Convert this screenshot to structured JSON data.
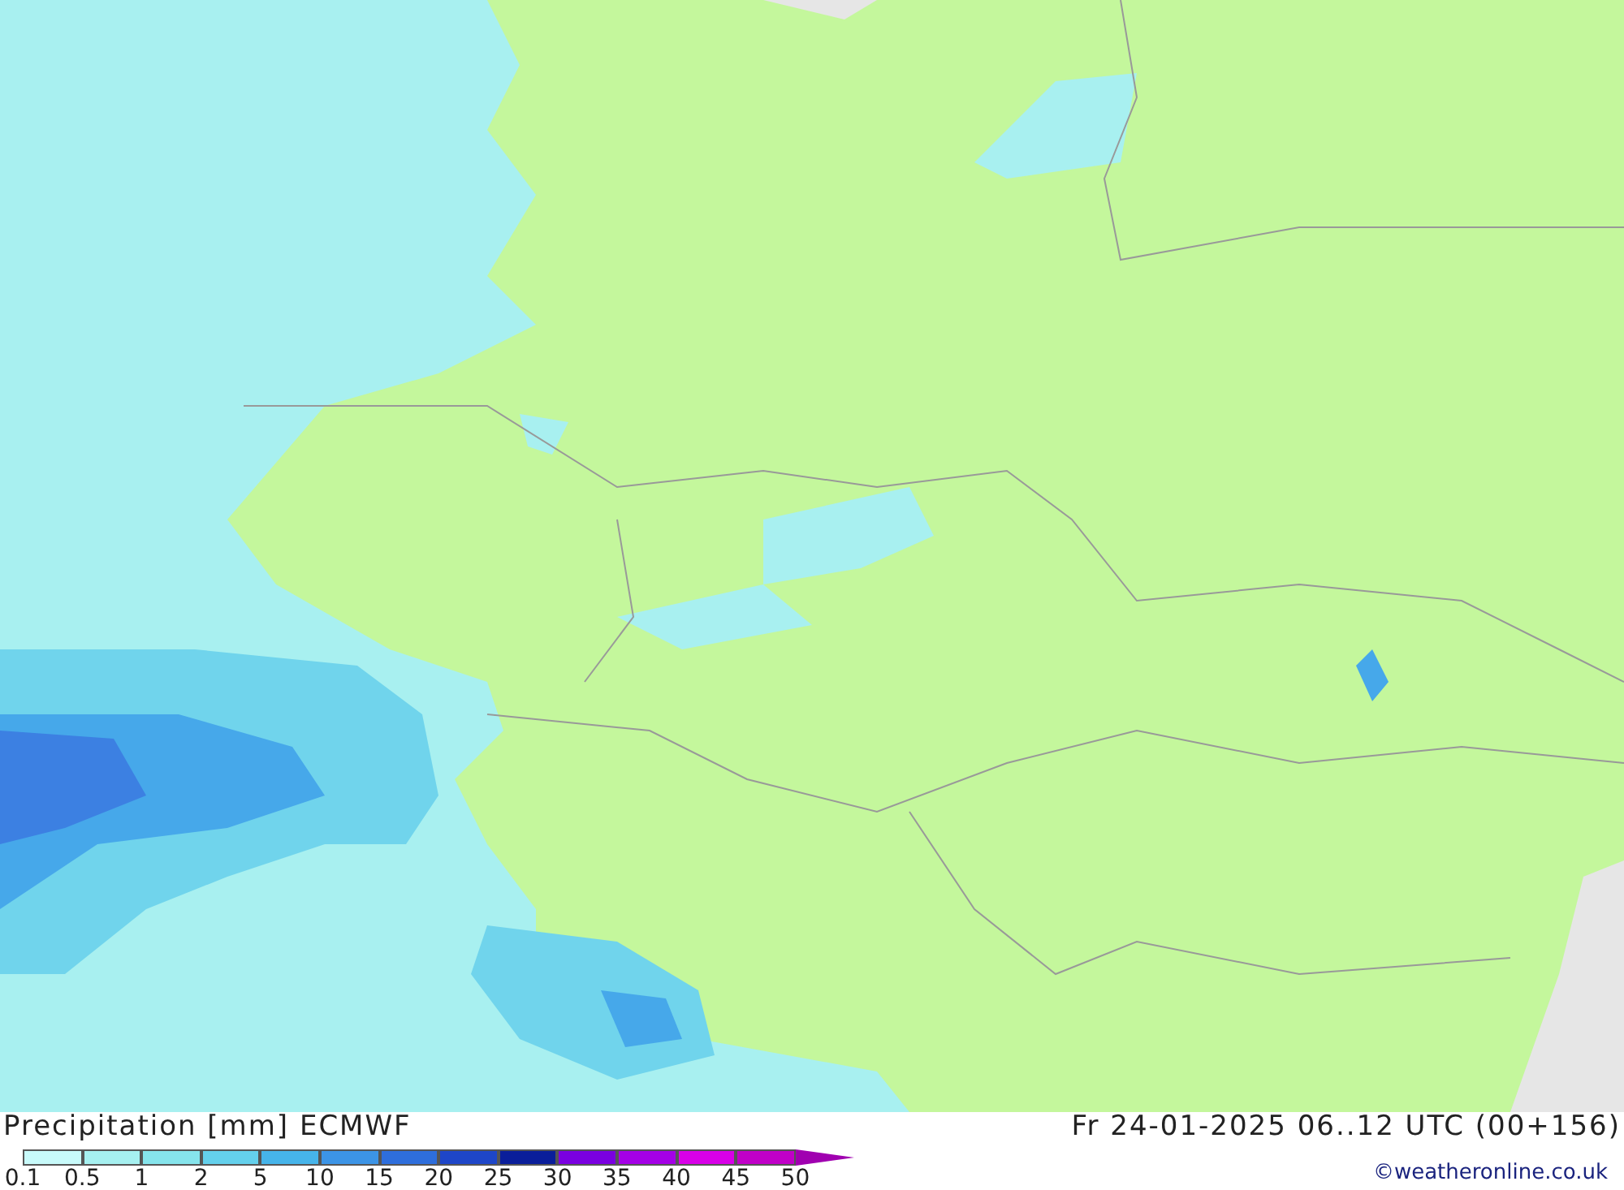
{
  "map": {
    "kind": "precipitation"
  },
  "footer": {
    "title": "Precipitation [mm] ECMWF",
    "valid_time": "Fr 24-01-2025 06..12 UTC (00+156)",
    "credit": "©weatheronline.co.uk"
  },
  "legend": [
    {
      "label": "0.1",
      "color": "#c8fafa"
    },
    {
      "label": "0.5",
      "color": "#a6f0f0"
    },
    {
      "label": "1",
      "color": "#86e4ec"
    },
    {
      "label": "2",
      "color": "#64d0ec"
    },
    {
      "label": "5",
      "color": "#46b4ea"
    },
    {
      "label": "10",
      "color": "#3c94e6"
    },
    {
      "label": "15",
      "color": "#2e6edc"
    },
    {
      "label": "20",
      "color": "#1e46c8"
    },
    {
      "label": "25",
      "color": "#0a1e9a"
    },
    {
      "label": "30",
      "color": "#7a00e0"
    },
    {
      "label": "35",
      "color": "#a400e6"
    },
    {
      "label": "40",
      "color": "#d800e8"
    },
    {
      "label": "45",
      "color": "#c000c8"
    },
    {
      "label": "50",
      "color": "#a000b0"
    }
  ]
}
